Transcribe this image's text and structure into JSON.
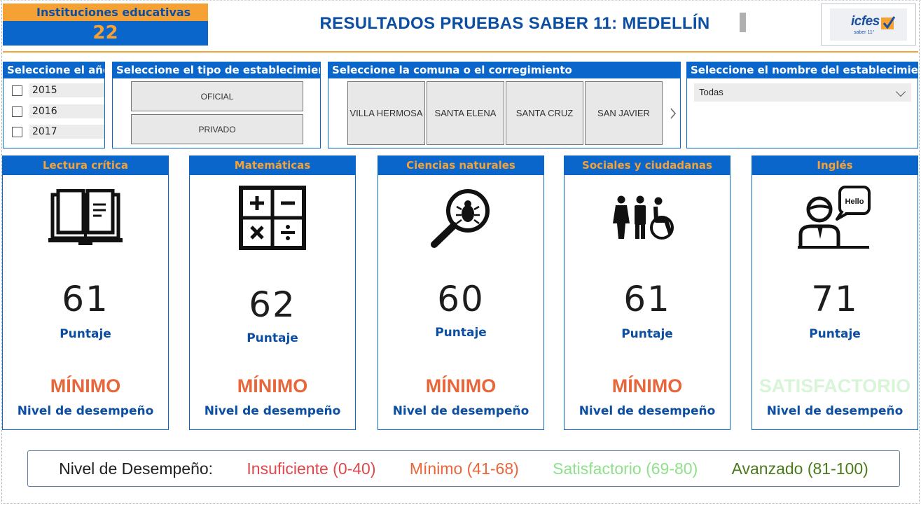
{
  "header": {
    "institutions_label": "Instituciones educativas",
    "institutions_value": "22",
    "title": "RESULTADOS PRUEBAS SABER 11: MEDELLÍN",
    "logo_text": "icfes",
    "logo_sub": "saber 11°"
  },
  "filters": {
    "year": {
      "title": "Seleccione el año",
      "options": [
        "2015",
        "2016",
        "2017"
      ]
    },
    "establishment_type": {
      "title": "Seleccione el tipo de establecimiento",
      "options": [
        "OFICIAL",
        "PRIVADO"
      ]
    },
    "comuna": {
      "title": "Seleccione la comuna o el corregimiento",
      "options": [
        "VILLA HERMOSA",
        "SANTA ELENA",
        "SANTA CRUZ",
        "SAN JAVIER"
      ]
    },
    "establishment_name": {
      "title": "Seleccione el nombre del establecimiento",
      "selected": "Todas"
    }
  },
  "subjects": [
    {
      "title": "Lectura crítica",
      "icon": "book-icon",
      "score": "61",
      "score_label": "Puntaje",
      "level": "MÍNIMO",
      "level_label": "Nivel de desempeño"
    },
    {
      "title": "Matemáticas",
      "icon": "calculator-icon",
      "score": "62",
      "score_label": "Puntaje",
      "level": "MÍNIMO",
      "level_label": "Nivel de desempeño"
    },
    {
      "title": "Ciencias naturales",
      "icon": "magnifier-bug-icon",
      "score": "60",
      "score_label": "Puntaje",
      "level": "MÍNIMO",
      "level_label": "Nivel de desempeño"
    },
    {
      "title": "Sociales y ciudadanas",
      "icon": "people-icon",
      "score": "61",
      "score_label": "Puntaje",
      "level": "MÍNIMO",
      "level_label": "Nivel de desempeño"
    },
    {
      "title": "Inglés",
      "icon": "speaker-hello-icon",
      "score": "71",
      "score_label": "Puntaje",
      "level": "SATISFACTORIO",
      "level_label": "Nivel de desempeño"
    }
  ],
  "icon_texts": {
    "hello": "Hello"
  },
  "legend": {
    "title": "Nivel de Desempeño:",
    "items": [
      {
        "label": "Insuficiente (0-40)",
        "color": "#e0474c"
      },
      {
        "label": "Mínimo (41-68)",
        "color": "#e8663a"
      },
      {
        "label": "Satisfactorio (69-80)",
        "color": "#8fe08a"
      },
      {
        "label": "Avanzado (81-100)",
        "color": "#4a7a1a"
      }
    ]
  },
  "colors": {
    "primary_blue": "#0b66cc",
    "accent_orange": "#f5a133",
    "minimo": "#e8663a",
    "satisfactorio": "#d8f5d8"
  }
}
